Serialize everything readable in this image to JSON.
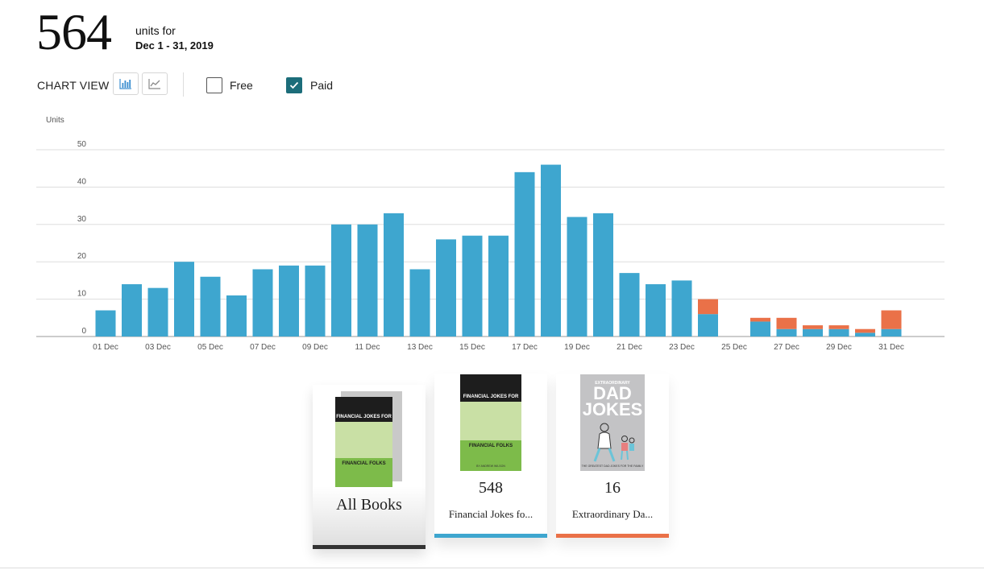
{
  "summary": {
    "total": "564",
    "units_for": "units for",
    "date_range": "Dec 1 - 31, 2019"
  },
  "controls": {
    "chart_view_label": "CHART VIEW",
    "bar_view_icon": "bar-chart-icon",
    "line_view_icon": "line-chart-icon",
    "active_view": "bar",
    "free_label": "Free",
    "free_checked": false,
    "paid_label": "Paid",
    "paid_checked": true
  },
  "colors": {
    "paid": "#3ea6cf",
    "free": "#ea7148",
    "checkbox_checked": "#1c6d7a",
    "icon_active": "#3a8ed0"
  },
  "chart_data": {
    "type": "bar",
    "stacked": true,
    "ylabel": "Units",
    "ylim": [
      0,
      50
    ],
    "yticks": [
      "0",
      "10",
      "20",
      "30",
      "40",
      "50"
    ],
    "grid": true,
    "x_tick_labels": [
      "01 Dec",
      "03 Dec",
      "05 Dec",
      "07 Dec",
      "09 Dec",
      "11 Dec",
      "13 Dec",
      "15 Dec",
      "17 Dec",
      "19 Dec",
      "21 Dec",
      "23 Dec",
      "25 Dec",
      "27 Dec",
      "29 Dec",
      "31 Dec"
    ],
    "categories": [
      "01 Dec",
      "02 Dec",
      "03 Dec",
      "04 Dec",
      "05 Dec",
      "06 Dec",
      "07 Dec",
      "08 Dec",
      "09 Dec",
      "10 Dec",
      "11 Dec",
      "12 Dec",
      "13 Dec",
      "14 Dec",
      "15 Dec",
      "16 Dec",
      "17 Dec",
      "18 Dec",
      "19 Dec",
      "20 Dec",
      "21 Dec",
      "22 Dec",
      "23 Dec",
      "24 Dec",
      "25 Dec",
      "26 Dec",
      "27 Dec",
      "28 Dec",
      "29 Dec",
      "30 Dec",
      "31 Dec"
    ],
    "series": [
      {
        "values": [
          7,
          14,
          13,
          20,
          16,
          11,
          18,
          19,
          19,
          30,
          30,
          33,
          18,
          26,
          27,
          27,
          44,
          46,
          32,
          33,
          17,
          14,
          15,
          6,
          0,
          4,
          2,
          2,
          2,
          1,
          2
        ]
      },
      {
        "values": [
          0,
          0,
          0,
          0,
          0,
          0,
          0,
          0,
          0,
          0,
          0,
          0,
          0,
          0,
          0,
          0,
          0,
          0,
          0,
          0,
          0,
          0,
          0,
          4,
          0,
          1,
          3,
          1,
          1,
          1,
          5
        ]
      }
    ]
  },
  "books": [
    {
      "title": "All Books",
      "count": ""
    },
    {
      "title": "Financial Jokes fo...",
      "count": "548",
      "color": "#3ea6cf",
      "cover": {
        "top": "FINANCIAL JOKES FOR",
        "bottom": "FINANCIAL FOLKS",
        "small": "BY ANDREW WILSON"
      }
    },
    {
      "title": "Extraordinary Da...",
      "count": "16",
      "color": "#ea7148",
      "cover": {
        "top": "EXTRAORDINARY",
        "main": "DAD JOKES",
        "small": "THE GREATEST DAD JOKES FOR THE FAMILY"
      }
    }
  ]
}
